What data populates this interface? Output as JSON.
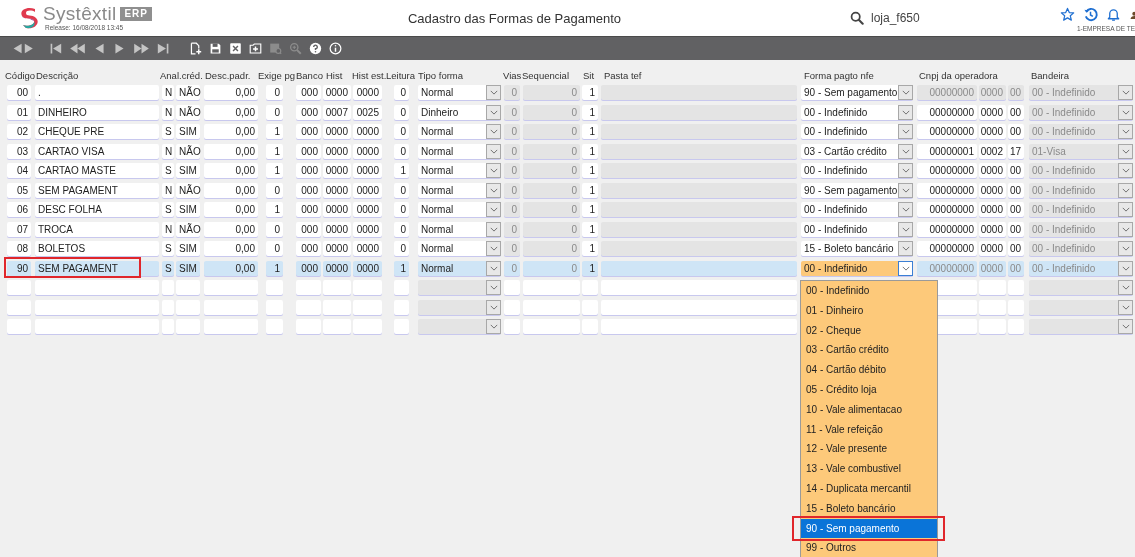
{
  "header": {
    "logo_word": "Systêxtil",
    "logo_badge": "ERP",
    "release": "Release: 16/08/2018 13:45",
    "title": "Cadastro das Formas de Pagamento",
    "search_value": "loja_f650",
    "company": "1-EMPRESA DE TE"
  },
  "toolbar": [
    {
      "kind": "prev-next",
      "disabled": false
    },
    {
      "kind": "first",
      "disabled": false
    },
    {
      "kind": "fast-back",
      "disabled": false
    },
    {
      "kind": "back",
      "disabled": false
    },
    {
      "kind": "forward",
      "disabled": false
    },
    {
      "kind": "fast-forward",
      "disabled": false
    },
    {
      "kind": "last",
      "disabled": false
    },
    {
      "kind": "new",
      "disabled": false
    },
    {
      "kind": "save",
      "disabled": false
    },
    {
      "kind": "delete",
      "disabled": false
    },
    {
      "kind": "add",
      "disabled": false
    },
    {
      "kind": "grid-search",
      "disabled": true
    },
    {
      "kind": "zoom",
      "disabled": true
    },
    {
      "kind": "help",
      "disabled": false
    },
    {
      "kind": "info",
      "disabled": false
    }
  ],
  "columns": [
    "Código",
    "Descrição",
    "Anal.créd.",
    "Desc.padr.",
    "Exige pg",
    "Banco",
    "Hist",
    "Hist est.",
    "Leitura",
    "Tipo forma",
    "Vias",
    "Sequencial",
    "Sit",
    "Pasta tef",
    "Forma pagto nfe",
    "Cnpj da operadora",
    "Bandeira"
  ],
  "rows": [
    {
      "kind": "record",
      "codigo": "00",
      "descricao": ".",
      "anal": "N",
      "cred": "NÃO",
      "desc_padr": "0,00",
      "exige_pg": "0",
      "banco": "000",
      "hist": "0000",
      "hist_est": "0000",
      "leitura": "0",
      "tipo_forma": "Normal",
      "vias": "0",
      "sequencial": "0",
      "sit": "1",
      "forma_pagto_nfe": "90 - Sem pagamento",
      "cnpj_1": "00000000",
      "cnpj_2": "0000",
      "cnpj_3": "00",
      "bandeira": "00 - Indefinido",
      "cnpj_disabled": true,
      "selected": false,
      "outlined": false,
      "dropdown_open": false
    },
    {
      "kind": "record",
      "codigo": "01",
      "descricao": "DINHEIRO",
      "anal": "N",
      "cred": "NÃO",
      "desc_padr": "0,00",
      "exige_pg": "0",
      "banco": "000",
      "hist": "0007",
      "hist_est": "0025",
      "leitura": "0",
      "tipo_forma": "Dinheiro",
      "vias": "0",
      "sequencial": "0",
      "sit": "1",
      "forma_pagto_nfe": "00 - Indefinido",
      "cnpj_1": "00000000",
      "cnpj_2": "0000",
      "cnpj_3": "00",
      "bandeira": "00 - Indefinido",
      "cnpj_disabled": false,
      "selected": false,
      "outlined": false,
      "dropdown_open": false
    },
    {
      "kind": "record",
      "codigo": "02",
      "descricao": "CHEQUE PRE",
      "anal": "S",
      "cred": "SIM",
      "desc_padr": "0,00",
      "exige_pg": "1",
      "banco": "000",
      "hist": "0000",
      "hist_est": "0000",
      "leitura": "0",
      "tipo_forma": "Normal",
      "vias": "0",
      "sequencial": "0",
      "sit": "1",
      "forma_pagto_nfe": "00 - Indefinido",
      "cnpj_1": "00000000",
      "cnpj_2": "0000",
      "cnpj_3": "00",
      "bandeira": "00 - Indefinido",
      "cnpj_disabled": false,
      "selected": false,
      "outlined": false,
      "dropdown_open": false
    },
    {
      "kind": "record",
      "codigo": "03",
      "descricao": "CARTAO VISA",
      "anal": "N",
      "cred": "NÃO",
      "desc_padr": "0,00",
      "exige_pg": "1",
      "banco": "000",
      "hist": "0000",
      "hist_est": "0000",
      "leitura": "0",
      "tipo_forma": "Normal",
      "vias": "0",
      "sequencial": "0",
      "sit": "1",
      "forma_pagto_nfe": "03 - Cartão crédito",
      "cnpj_1": "00000001",
      "cnpj_2": "0002",
      "cnpj_3": "17",
      "bandeira": "01-Visa",
      "cnpj_disabled": false,
      "selected": false,
      "outlined": false,
      "dropdown_open": false
    },
    {
      "kind": "record",
      "codigo": "04",
      "descricao": "CARTAO MASTE",
      "anal": "S",
      "cred": "SIM",
      "desc_padr": "0,00",
      "exige_pg": "1",
      "banco": "000",
      "hist": "0000",
      "hist_est": "0000",
      "leitura": "1",
      "tipo_forma": "Normal",
      "vias": "0",
      "sequencial": "0",
      "sit": "1",
      "forma_pagto_nfe": "00 - Indefinido",
      "cnpj_1": "00000000",
      "cnpj_2": "0000",
      "cnpj_3": "00",
      "bandeira": "00 - Indefinido",
      "cnpj_disabled": false,
      "selected": false,
      "outlined": false,
      "dropdown_open": false
    },
    {
      "kind": "record",
      "codigo": "05",
      "descricao": "SEM PAGAMENT",
      "anal": "N",
      "cred": "NÃO",
      "desc_padr": "0,00",
      "exige_pg": "0",
      "banco": "000",
      "hist": "0000",
      "hist_est": "0000",
      "leitura": "0",
      "tipo_forma": "Normal",
      "vias": "0",
      "sequencial": "0",
      "sit": "1",
      "forma_pagto_nfe": "90 - Sem pagamento",
      "cnpj_1": "00000000",
      "cnpj_2": "0000",
      "cnpj_3": "00",
      "bandeira": "00 - Indefinido",
      "cnpj_disabled": false,
      "selected": false,
      "outlined": false,
      "dropdown_open": false
    },
    {
      "kind": "record",
      "codigo": "06",
      "descricao": "DESC FOLHA",
      "anal": "S",
      "cred": "SIM",
      "desc_padr": "0,00",
      "exige_pg": "1",
      "banco": "000",
      "hist": "0000",
      "hist_est": "0000",
      "leitura": "0",
      "tipo_forma": "Normal",
      "vias": "0",
      "sequencial": "0",
      "sit": "1",
      "forma_pagto_nfe": "00 - Indefinido",
      "cnpj_1": "00000000",
      "cnpj_2": "0000",
      "cnpj_3": "00",
      "bandeira": "00 - Indefinido",
      "cnpj_disabled": false,
      "selected": false,
      "outlined": false,
      "dropdown_open": false
    },
    {
      "kind": "record",
      "codigo": "07",
      "descricao": "TROCA",
      "anal": "N",
      "cred": "NÃO",
      "desc_padr": "0,00",
      "exige_pg": "0",
      "banco": "000",
      "hist": "0000",
      "hist_est": "0000",
      "leitura": "0",
      "tipo_forma": "Normal",
      "vias": "0",
      "sequencial": "0",
      "sit": "1",
      "forma_pagto_nfe": "00 - Indefinido",
      "cnpj_1": "00000000",
      "cnpj_2": "0000",
      "cnpj_3": "00",
      "bandeira": "00 - Indefinido",
      "cnpj_disabled": false,
      "selected": false,
      "outlined": false,
      "dropdown_open": false
    },
    {
      "kind": "record",
      "codigo": "08",
      "descricao": "BOLETOS",
      "anal": "S",
      "cred": "SIM",
      "desc_padr": "0,00",
      "exige_pg": "0",
      "banco": "000",
      "hist": "0000",
      "hist_est": "0000",
      "leitura": "0",
      "tipo_forma": "Normal",
      "vias": "0",
      "sequencial": "0",
      "sit": "1",
      "forma_pagto_nfe": "15 - Boleto bancário",
      "cnpj_1": "00000000",
      "cnpj_2": "0000",
      "cnpj_3": "00",
      "bandeira": "00 - Indefinido",
      "cnpj_disabled": false,
      "selected": false,
      "outlined": false,
      "dropdown_open": false
    },
    {
      "kind": "record",
      "codigo": "90",
      "descricao": "SEM PAGAMENT",
      "anal": "S",
      "cred": "SIM",
      "desc_padr": "0,00",
      "exige_pg": "1",
      "banco": "000",
      "hist": "0000",
      "hist_est": "0000",
      "leitura": "1",
      "tipo_forma": "Normal",
      "vias": "0",
      "sequencial": "0",
      "sit": "1",
      "forma_pagto_nfe": "00 - Indefinido",
      "cnpj_1": "00000000",
      "cnpj_2": "0000",
      "cnpj_3": "00",
      "bandeira": "00 - Indefinido",
      "cnpj_disabled": true,
      "selected": true,
      "outlined": true,
      "dropdown_open": true
    },
    {
      "kind": "blank"
    },
    {
      "kind": "blank"
    },
    {
      "kind": "blank"
    }
  ],
  "nfe_dropdown": {
    "options": [
      {
        "label": "00 - Indefinido",
        "selected": false,
        "outlined": false
      },
      {
        "label": "01 - Dinheiro",
        "selected": false,
        "outlined": false
      },
      {
        "label": "02 - Cheque",
        "selected": false,
        "outlined": false
      },
      {
        "label": "03 - Cartão crédito",
        "selected": false,
        "outlined": false
      },
      {
        "label": "04 - Cartão débito",
        "selected": false,
        "outlined": false
      },
      {
        "label": "05 - Crédito loja",
        "selected": false,
        "outlined": false
      },
      {
        "label": "10 - Vale alimentacao",
        "selected": false,
        "outlined": false
      },
      {
        "label": "11 - Vale refeição",
        "selected": false,
        "outlined": false
      },
      {
        "label": "12 - Vale presente",
        "selected": false,
        "outlined": false
      },
      {
        "label": "13 - Vale combustivel",
        "selected": false,
        "outlined": false
      },
      {
        "label": "14 - Duplicata mercantil",
        "selected": false,
        "outlined": false
      },
      {
        "label": "15 - Boleto bancário",
        "selected": false,
        "outlined": false
      },
      {
        "label": "90 - Sem pagamento",
        "selected": true,
        "outlined": true
      },
      {
        "label": "99 - Outros",
        "selected": false,
        "outlined": false
      }
    ]
  }
}
